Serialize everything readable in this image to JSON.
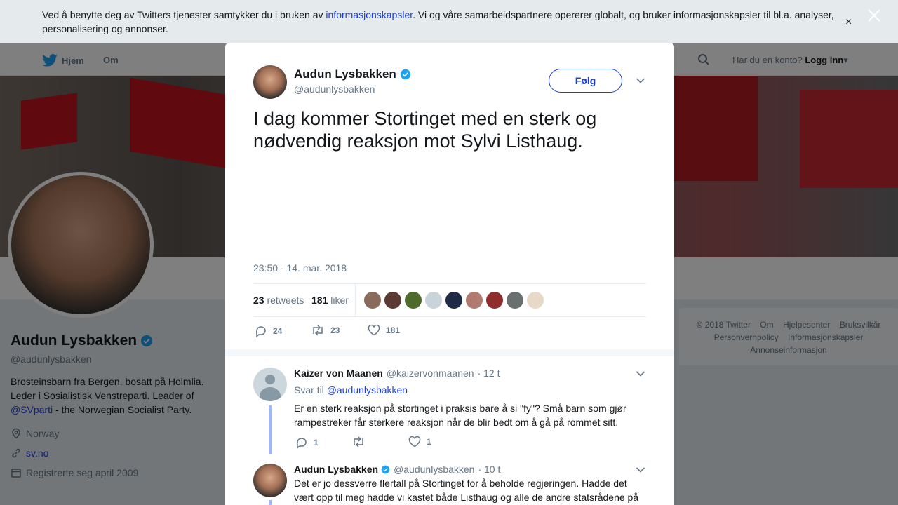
{
  "cookie_bar": {
    "text_before": "Ved å benytte deg av Twitters tjenester samtykker du i bruken av ",
    "link": "informasjonskapsler",
    "text_after": ". Vi og våre samarbeidspartnere opererer globalt, og bruker informasjonskapsler til bl.a. analyser, personalisering og annonser.",
    "close_label": "×"
  },
  "nav": {
    "home_label": "Hjem",
    "about_label": "Om",
    "account_prompt": "Har du en konto?",
    "login_label": "Logg inn"
  },
  "profile": {
    "name": "Audun Lysbakken",
    "handle": "@audunlysbakken",
    "bio_1": "Brosteinsbarn fra Bergen, bosatt på Holmlia. Leder i Sosialistisk Venstreparti. Leader of ",
    "bio_link": "@SVparti",
    "bio_2": " - the Norwegian Socialist Party.",
    "location": "Norway",
    "website": "sv.no",
    "joined": "Registrerte seg april 2009"
  },
  "footer": {
    "links": [
      "© 2018 Twitter",
      "Om",
      "Hjelpesenter",
      "Bruksvilkår",
      "Personvernpolicy",
      "Informasjonskapsler",
      "Annonseinformasjon"
    ]
  },
  "tweet": {
    "author_name": "Audun Lysbakken",
    "author_handle": "@audunlysbakken",
    "follow_label": "Følg",
    "text": "I dag kommer Stortinget med en sterk og nødvendig reaksjon mot Sylvi Listhaug.",
    "timestamp": "23:50 - 14. mar. 2018",
    "retweets_count": "23",
    "retweets_label": "retweets",
    "likes_count": "181",
    "likes_label": "liker",
    "liker_colors": [
      "#8a6a5a",
      "#5a3a33",
      "#4f6b2c",
      "#c9d3da",
      "#1f2a44",
      "#b07a70",
      "#8f2d2d",
      "#6a6f70",
      "#e8d8c8"
    ],
    "actions": {
      "replies": "24",
      "retweets": "23",
      "likes": "181"
    }
  },
  "replies": [
    {
      "name": "Kaizer von Maanen",
      "handle": "@kaizervonmaanen",
      "time": "· 12 t",
      "reply_to_label": "Svar til",
      "reply_to_link": "@audunlysbakken",
      "text": "Er en sterk reaksjon på stortinget i praksis bare å si \"fy\"? Små barn som gjør rampestreker får sterkere reaksjon når de blir bedt om å gå på rommet sitt.",
      "replies": "1",
      "retweets": "",
      "likes": "1"
    },
    {
      "name": "Audun Lysbakken",
      "handle": "@audunlysbakken",
      "time": "· 10 t",
      "text": "Det er jo dessverre flertall på Stortinget for å beholde regjeringen. Hadde det vært opp til meg hadde vi kastet både Listhaug og alle de andre statsrådene på"
    }
  ]
}
